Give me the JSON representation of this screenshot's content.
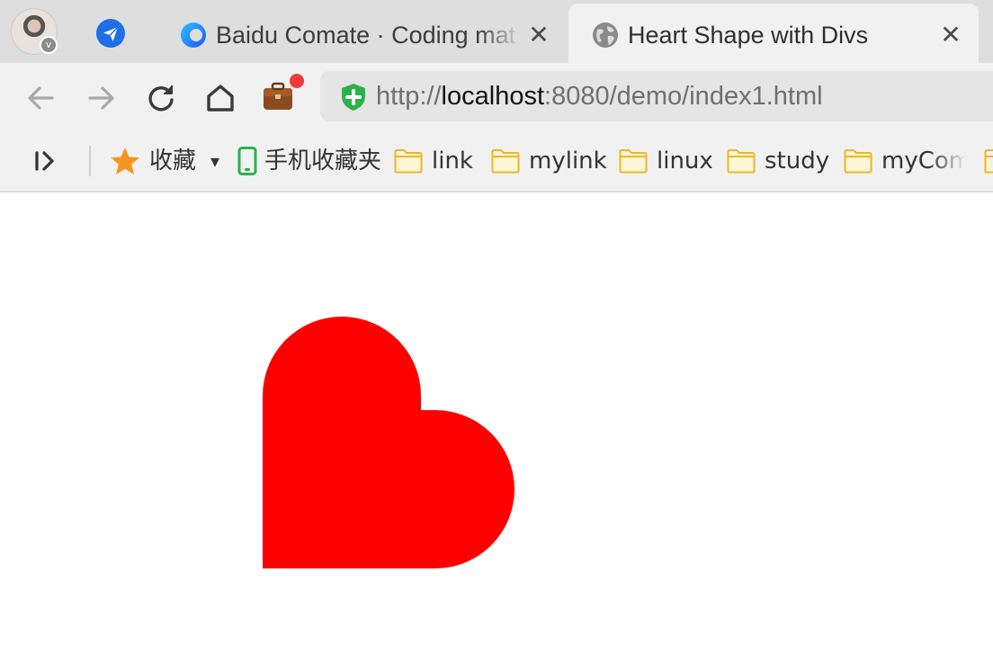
{
  "tabs": [
    {
      "title": "Baidu Comate · Coding mat",
      "icon": "comate-icon",
      "active": false
    },
    {
      "title": "Heart Shape with Divs",
      "icon": "globe-icon",
      "active": true
    }
  ],
  "tab_close_glyph": "✕",
  "profile": {
    "badge": "v"
  },
  "address_bar": {
    "scheme": "http://",
    "host": "localhost",
    "rest": ":8080/demo/index1.html"
  },
  "bookmarks": {
    "favorites_label": "收藏",
    "dropdown_glyph": "▾",
    "mobile_label": "手机收藏夹",
    "folders": [
      "link",
      "mylink",
      "linux",
      "study",
      "myCom"
    ]
  },
  "colors": {
    "heart": "#ff0000",
    "folder": "#f5c542",
    "star": "#f7941d",
    "shield": "#2bb24c"
  }
}
